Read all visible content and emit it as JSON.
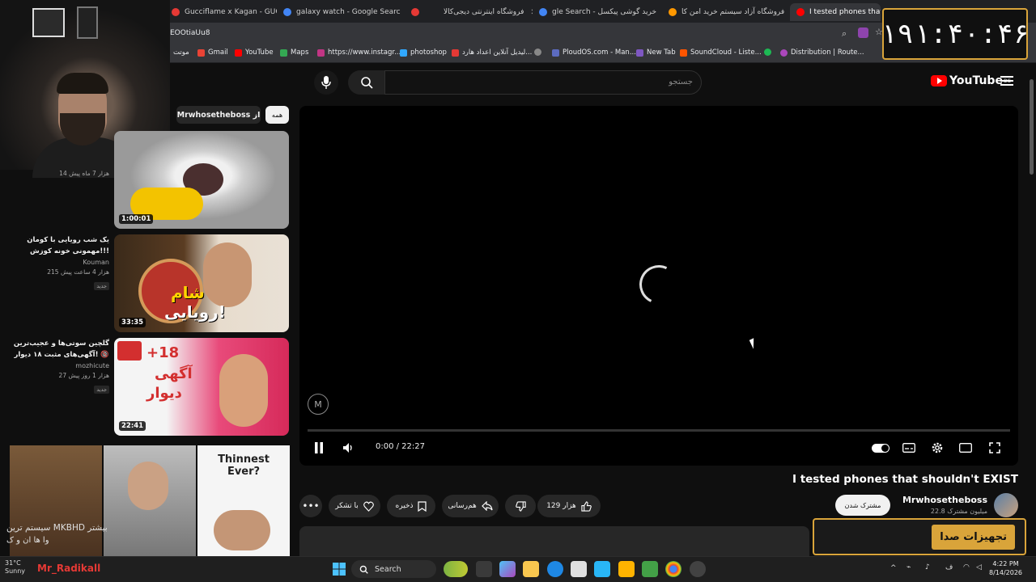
{
  "browser": {
    "tabs": [
      {
        "title": "Gucciflame x Kagan - GUCCI G/",
        "color": "#e53935"
      },
      {
        "title": "galaxy watch - Google Search",
        "color": "#4285f4"
      },
      {
        "title": "",
        "color": "#e53935"
      },
      {
        "title": "فروشگاه اینترنتی دیجی‌کالا",
        "color": "#ef394e"
      },
      {
        "title": "gle Search - خرید گوشی پیکسل",
        "color": "#4285f4"
      },
      {
        "title": "فروشگاه آزاد سیستم خرید امن کا",
        "color": "#ff9800"
      },
      {
        "title": "I tested phones that shouldn't",
        "color": "#ff0000"
      }
    ],
    "url": "EOOtiaUu8",
    "bookmarks": [
      "موتت",
      "Gmail",
      "YouTube",
      "Maps",
      "https://www.instagr...",
      "photoshop",
      "لیدیل آنلاین اعداد هارد...",
      "PloudOS.com - Man...",
      "New Tab",
      "SoundCloud - Liste...",
      "Distribution | Route..."
    ]
  },
  "clock_overlay": "۱۹۱:۴۰:۴۶",
  "youtube": {
    "logo_text": "YouTube",
    "logo_region": "DE",
    "search_placeholder": "جستجو",
    "filters": {
      "all": "همه",
      "channel": "Mrwhosetheboss از"
    },
    "player": {
      "time": "0:00 / 22:27",
      "watermark": "M"
    },
    "video": {
      "title": "I tested phones that shouldn't EXIST",
      "channel": "Mrwhosetheboss",
      "subscribers": "22.8 میلیون مشترک",
      "subscribe_label": "مشترک شدن",
      "likes": "129 هزار",
      "share_label": "هم‌رسانی",
      "save_label": "ذخیره",
      "thanks_label": "با تشکر"
    },
    "sidebar_videos": [
      {
        "duration": "1:00:01",
        "title": "",
        "channel": "",
        "meta": "14 هزار  7 ماه پیش",
        "is_new": false
      },
      {
        "duration": "33:35",
        "title": "یک شب رویایی با کومان مهمونی خونه کوزش!!!",
        "channel": "Kouman",
        "meta": "215 هزار  4 ساعت پیش",
        "is_new": true,
        "new_label": "جدید"
      },
      {
        "duration": "22:41",
        "title": "گلچین سوتی‌ها و عجیب‌ترین آگهی‌های مثبت ۱۸ دیوار! 🔞",
        "channel": "mozhicute",
        "meta": "27 هزار  1 روز پیش",
        "is_new": true,
        "new_label": "جدید"
      }
    ],
    "bottom_thumb_text": "Thinnest Ever?"
  },
  "stream_overlay": {
    "chat_line1": "سیستم ترین MKBHD بیشتر",
    "chat_line2": "وا ها ان و ک",
    "username": "Mr_Radikall",
    "sponsor": "تجهیزات صدا"
  },
  "taskbar": {
    "weather_temp": "31°C",
    "weather_desc": "Sunny",
    "search_label": "Search",
    "time": "4:22 PM",
    "date": "8/14/2026"
  },
  "colors": {
    "accent": "#d9a43a",
    "youtube_red": "#ff0000",
    "username_red": "#e53935"
  }
}
